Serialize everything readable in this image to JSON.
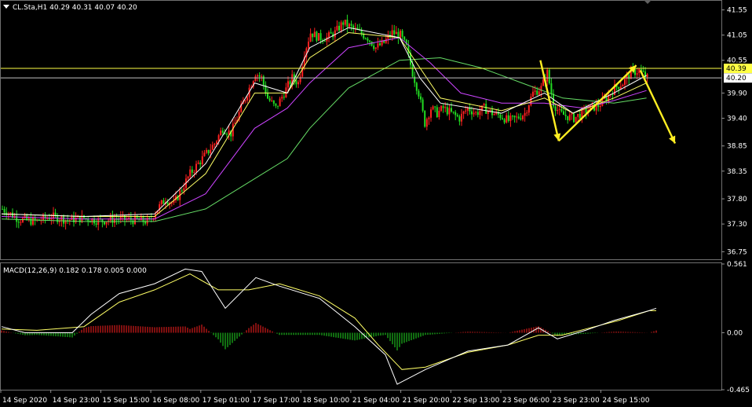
{
  "header": {
    "symbol_line": "CL.Sta,H1  40.29 40.31 40.07 40.20",
    "macd_line": "MACD(12,26,9) 0.182 0.178 0.005 0.000"
  },
  "colors": {
    "background": "#000000",
    "bull": "#ff2020",
    "bear": "#22dd22",
    "ma_fast": "#ffffff",
    "ma_mid": "#ffff66",
    "ma_slow": "#cc44ff",
    "ma_long": "#66dd66",
    "level": "#ffff44",
    "price_line": "#c0c0c0",
    "arrow": "#ffee22",
    "macd_main": "#ffffff",
    "macd_signal": "#ffff66"
  },
  "chart_data": [
    {
      "type": "candlestick",
      "panel": "price",
      "symbol": "CL.Sta",
      "timeframe": "H1",
      "ohlc": {
        "open": 40.29,
        "high": 40.31,
        "low": 40.07,
        "close": 40.2
      },
      "ylim": [
        36.6,
        41.7
      ],
      "yticks": [
        "41.55",
        "41.05",
        "40.55",
        "39.90",
        "39.40",
        "38.85",
        "38.35",
        "37.80",
        "37.30",
        "36.75"
      ],
      "ytick_values": [
        41.55,
        41.05,
        40.55,
        39.9,
        39.4,
        38.85,
        38.35,
        37.8,
        37.3,
        36.75
      ],
      "xticks": [
        "14 Sep 2020",
        "14 Sep 23:00",
        "15 Sep 15:00",
        "16 Sep 08:00",
        "17 Sep 01:00",
        "17 Sep 17:00",
        "18 Sep 10:00",
        "21 Sep 04:00",
        "21 Sep 20:00",
        "22 Sep 13:00",
        "23 Sep 06:00",
        "23 Sep 23:00",
        "24 Sep 15:00"
      ],
      "levels": [
        {
          "value": 40.39,
          "label": "40.39"
        }
      ],
      "current_price": {
        "value": 40.2,
        "label": "40.20"
      },
      "close_path": [
        [
          0,
          37.6
        ],
        [
          8,
          37.4
        ],
        [
          16,
          37.35
        ],
        [
          24,
          37.45
        ],
        [
          32,
          37.38
        ],
        [
          40,
          37.42
        ],
        [
          48,
          37.36
        ],
        [
          56,
          37.4
        ],
        [
          64,
          37.38
        ],
        [
          72,
          37.35
        ],
        [
          75,
          37.55
        ],
        [
          80,
          37.8
        ],
        [
          84,
          37.7
        ],
        [
          88,
          38.0
        ],
        [
          92,
          38.3
        ],
        [
          96,
          38.5
        ],
        [
          100,
          38.7
        ],
        [
          104,
          38.9
        ],
        [
          108,
          39.2
        ],
        [
          112,
          39.1
        ],
        [
          116,
          39.5
        ],
        [
          120,
          39.9
        ],
        [
          124,
          40.3
        ],
        [
          127,
          40.2
        ],
        [
          130,
          39.8
        ],
        [
          134,
          39.6
        ],
        [
          138,
          39.9
        ],
        [
          142,
          40.2
        ],
        [
          145,
          40.1
        ],
        [
          148,
          40.7
        ],
        [
          151,
          41.1
        ],
        [
          155,
          41.0
        ],
        [
          159,
          41.0
        ],
        [
          163,
          41.1
        ],
        [
          167,
          41.3
        ],
        [
          171,
          41.2
        ],
        [
          175,
          41.1
        ],
        [
          179,
          41.0
        ],
        [
          183,
          40.8
        ],
        [
          187,
          40.9
        ],
        [
          191,
          41.1
        ],
        [
          195,
          41.05
        ],
        [
          198,
          40.8
        ],
        [
          201,
          40.3
        ],
        [
          204,
          39.9
        ],
        [
          207,
          39.3
        ],
        [
          210,
          39.6
        ],
        [
          213,
          39.5
        ],
        [
          216,
          39.6
        ],
        [
          220,
          39.5
        ],
        [
          224,
          39.4
        ],
        [
          228,
          39.6
        ],
        [
          232,
          39.5
        ],
        [
          236,
          39.6
        ],
        [
          240,
          39.5
        ],
        [
          244,
          39.45
        ],
        [
          248,
          39.35
        ],
        [
          252,
          39.4
        ],
        [
          256,
          39.5
        ],
        [
          260,
          39.9
        ],
        [
          264,
          40.0
        ],
        [
          267,
          40.3
        ],
        [
          270,
          39.7
        ],
        [
          273,
          39.5
        ],
        [
          276,
          39.45
        ],
        [
          280,
          39.4
        ],
        [
          284,
          39.5
        ],
        [
          288,
          39.6
        ],
        [
          292,
          39.65
        ],
        [
          296,
          39.8
        ],
        [
          300,
          40.0
        ],
        [
          304,
          40.1
        ],
        [
          308,
          40.3
        ],
        [
          312,
          40.35
        ],
        [
          316,
          40.2
        ]
      ],
      "ma_white": [
        [
          0,
          37.5
        ],
        [
          40,
          37.45
        ],
        [
          75,
          37.5
        ],
        [
          100,
          38.5
        ],
        [
          124,
          40.1
        ],
        [
          140,
          39.9
        ],
        [
          151,
          40.8
        ],
        [
          170,
          41.2
        ],
        [
          195,
          41.0
        ],
        [
          205,
          40.2
        ],
        [
          215,
          39.7
        ],
        [
          245,
          39.5
        ],
        [
          266,
          39.9
        ],
        [
          280,
          39.5
        ],
        [
          300,
          39.9
        ],
        [
          316,
          40.25
        ]
      ],
      "ma_yellow": [
        [
          0,
          37.5
        ],
        [
          40,
          37.45
        ],
        [
          75,
          37.45
        ],
        [
          100,
          38.3
        ],
        [
          124,
          39.9
        ],
        [
          140,
          39.9
        ],
        [
          151,
          40.6
        ],
        [
          170,
          41.1
        ],
        [
          195,
          41.0
        ],
        [
          205,
          40.4
        ],
        [
          215,
          39.8
        ],
        [
          245,
          39.55
        ],
        [
          266,
          39.8
        ],
        [
          280,
          39.5
        ],
        [
          300,
          39.8
        ],
        [
          316,
          40.1
        ]
      ],
      "ma_purple": [
        [
          0,
          37.45
        ],
        [
          40,
          37.4
        ],
        [
          75,
          37.4
        ],
        [
          100,
          37.9
        ],
        [
          124,
          39.2
        ],
        [
          140,
          39.6
        ],
        [
          151,
          40.1
        ],
        [
          170,
          40.8
        ],
        [
          195,
          41.0
        ],
        [
          210,
          40.5
        ],
        [
          225,
          39.9
        ],
        [
          245,
          39.7
        ],
        [
          266,
          39.7
        ],
        [
          285,
          39.6
        ],
        [
          300,
          39.75
        ],
        [
          316,
          39.95
        ]
      ],
      "ma_green": [
        [
          0,
          37.4
        ],
        [
          40,
          37.35
        ],
        [
          75,
          37.35
        ],
        [
          100,
          37.6
        ],
        [
          124,
          38.2
        ],
        [
          140,
          38.6
        ],
        [
          151,
          39.2
        ],
        [
          170,
          40.0
        ],
        [
          195,
          40.55
        ],
        [
          215,
          40.6
        ],
        [
          235,
          40.4
        ],
        [
          255,
          40.1
        ],
        [
          275,
          39.8
        ],
        [
          300,
          39.7
        ],
        [
          316,
          39.8
        ]
      ],
      "annotations": [
        {
          "kind": "arrow",
          "from": [
            264,
            40.55
          ],
          "to": [
            273,
            38.95
          ]
        },
        {
          "kind": "arrow",
          "from": [
            273,
            38.95
          ],
          "to": [
            311,
            40.45
          ]
        },
        {
          "kind": "arrow",
          "from": [
            313,
            40.35
          ],
          "to": [
            330,
            38.9
          ]
        }
      ]
    },
    {
      "type": "bar+line",
      "panel": "macd",
      "indicator": "MACD(12,26,9)",
      "values": {
        "main": 0.182,
        "signal": 0.178,
        "hist": 0.005,
        "extra": 0.0
      },
      "ylim": [
        -0.465,
        0.561
      ],
      "yticks": [
        "0.561",
        "0.00",
        "-0.465"
      ],
      "ytick_values": [
        0.561,
        0.0,
        -0.465
      ],
      "macd_main": [
        [
          0,
          0.05
        ],
        [
          10,
          0.0
        ],
        [
          30,
          0.0
        ],
        [
          38,
          0.15
        ],
        [
          50,
          0.32
        ],
        [
          65,
          0.4
        ],
        [
          78,
          0.52
        ],
        [
          85,
          0.5
        ],
        [
          95,
          0.2
        ],
        [
          108,
          0.45
        ],
        [
          118,
          0.38
        ],
        [
          135,
          0.28
        ],
        [
          150,
          0.05
        ],
        [
          163,
          -0.18
        ],
        [
          168,
          -0.42
        ],
        [
          180,
          -0.3
        ],
        [
          198,
          -0.15
        ],
        [
          215,
          -0.1
        ],
        [
          228,
          0.04
        ],
        [
          236,
          -0.05
        ],
        [
          248,
          0.02
        ],
        [
          260,
          0.1
        ],
        [
          275,
          0.18
        ],
        [
          278,
          0.2
        ]
      ],
      "macd_signal": [
        [
          0,
          0.03
        ],
        [
          15,
          0.02
        ],
        [
          35,
          0.05
        ],
        [
          50,
          0.25
        ],
        [
          65,
          0.35
        ],
        [
          80,
          0.48
        ],
        [
          92,
          0.35
        ],
        [
          105,
          0.35
        ],
        [
          118,
          0.4
        ],
        [
          135,
          0.3
        ],
        [
          150,
          0.12
        ],
        [
          160,
          -0.1
        ],
        [
          170,
          -0.3
        ],
        [
          180,
          -0.28
        ],
        [
          198,
          -0.16
        ],
        [
          215,
          -0.1
        ],
        [
          228,
          -0.02
        ],
        [
          238,
          -0.02
        ],
        [
          250,
          0.04
        ],
        [
          262,
          0.1
        ],
        [
          275,
          0.18
        ],
        [
          278,
          0.18
        ]
      ]
    }
  ]
}
